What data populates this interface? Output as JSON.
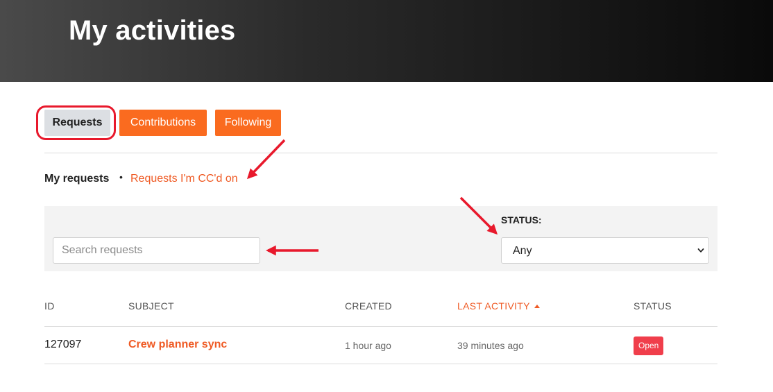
{
  "header": {
    "title": "My activities"
  },
  "tabs": [
    {
      "label": "Requests",
      "active": true
    },
    {
      "label": "Contributions",
      "active": false
    },
    {
      "label": "Following",
      "active": false
    }
  ],
  "subnav": {
    "current": "My requests",
    "separator": "•",
    "link": "Requests I'm CC'd on"
  },
  "filters": {
    "search_placeholder": "Search requests",
    "status_label": "STATUS:",
    "status_value": "Any"
  },
  "table": {
    "headers": {
      "id": "ID",
      "subject": "SUBJECT",
      "created": "CREATED",
      "last_activity": "LAST ACTIVITY",
      "status": "STATUS"
    },
    "sorted_by": "last_activity",
    "rows": [
      {
        "id": "127097",
        "subject": "Crew planner sync",
        "created": "1 hour ago",
        "last_activity": "39 minutes ago",
        "status": "Open"
      }
    ]
  },
  "colors": {
    "accent": "#fa6b1f",
    "link": "#ef5a24",
    "annotation": "#e8192c",
    "status_open": "#f03e4b"
  },
  "icons": {
    "select_caret": "chevron-down-icon",
    "sort": "sort-ascending-icon"
  }
}
